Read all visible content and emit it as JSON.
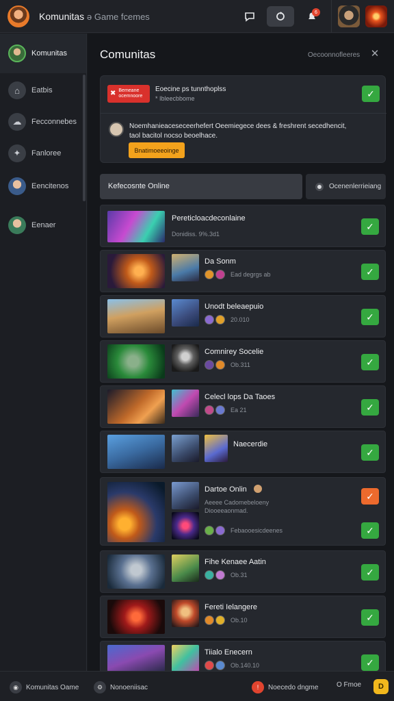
{
  "header": {
    "title": "Komunitas",
    "subtitle": "ə Game fcemes",
    "icons": [
      "chat-icon",
      "refresh-icon",
      "notification-icon"
    ],
    "notification_count": "6"
  },
  "sidebar": {
    "profile_label": "Komunitas",
    "items": [
      {
        "label": "Eatbis",
        "icon": "home-icon"
      },
      {
        "label": "Fecconnebes",
        "icon": "cloud-icon"
      },
      {
        "label": "Fanloree",
        "icon": "explore-icon"
      },
      {
        "label": "Eencitenos",
        "icon": "friends-icon"
      },
      {
        "label": "Eenaer",
        "icon": "user-icon"
      }
    ]
  },
  "main": {
    "title": "Comunitas",
    "top_right": "Oecoonnofleeres",
    "notice": {
      "badge_text": "Bemeane ocemnoore",
      "line1": "Eoecine ps tunnthoplss",
      "line2": "* Ibleecbbome",
      "message_line1": "Noemhanieaceseceerhefert Oeemiegece dees & freshrent secedhencit,",
      "message_line2": "taol bacitol nocso beoelhace.",
      "button": "Bnatimoeeoinge"
    },
    "filter_label": "Kefecosnte Online",
    "filter_button": "Ocenenlerrieiang",
    "rows": [
      {
        "title": "Pereticloacdeconlaine",
        "subtitle": "Donidiss. 9%.3d1",
        "status": "ok"
      },
      {
        "title": "Da Sonm",
        "subtitle": "Ead degrgs ab",
        "status": "ok"
      },
      {
        "title": "Unodt beleaepuio",
        "subtitle": "20.010",
        "status": "ok"
      },
      {
        "title": "Comnirey Socelie",
        "subtitle": "Ob.311",
        "status": "ok"
      },
      {
        "title": "Celecl lops Da Taoes",
        "subtitle": "Ea 21",
        "status": "ok"
      },
      {
        "title": "Naecerdie",
        "subtitle": "",
        "status": "ok"
      },
      {
        "title": "Dartoe Onlin",
        "subtitle": "Aeeee Cadomebeloeny",
        "subtitle2": "Diooeeaonmad.",
        "subtitle3": "Febaooesicdeenes",
        "status": "warn"
      },
      {
        "title": "Fihe Kenaee Aatin",
        "subtitle": "Ob.31",
        "status": "ok"
      },
      {
        "title": "Fereti Ielangere",
        "subtitle": "Ob.10",
        "status": "ok"
      },
      {
        "title": "Tiialo Enecern",
        "subtitle": "Ob.140.10",
        "status": "ok"
      }
    ]
  },
  "footer": {
    "left": "Komunitas Oame",
    "mid": "Nonoeniisac",
    "right1": "Noecedo dngme",
    "right2": "O Fmoe"
  },
  "colors": {
    "accent_green": "#35a840",
    "accent_orange": "#ed6a2d",
    "warning_yellow": "#f3a21c",
    "alert_red": "#d9312c"
  }
}
